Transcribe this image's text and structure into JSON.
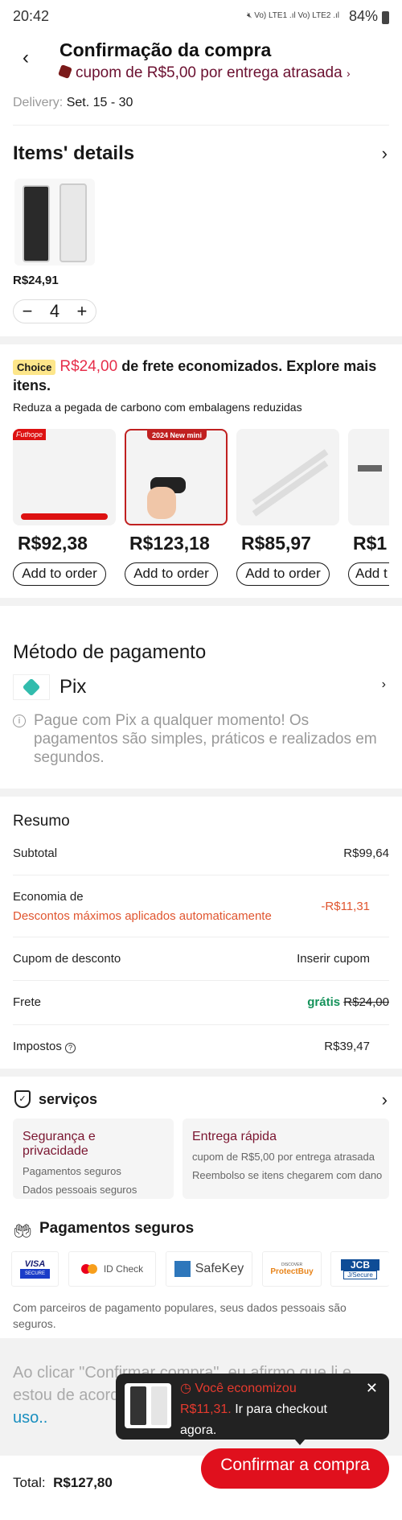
{
  "status_bar": {
    "time": "20:42",
    "battery": "84%",
    "network": "Vo) LTE1 .ıl Vo) LTE2 .ıl"
  },
  "header": {
    "title": "Confirmação da compra",
    "coupon": "cupom de R$5,00 por entrega atrasada"
  },
  "delivery": {
    "label": "Delivery:",
    "value": "Set. 15 - 30"
  },
  "items": {
    "title": "Items' details",
    "price": "R$24,91",
    "quantity": "4",
    "minus": "−",
    "plus": "+"
  },
  "choice": {
    "badge": "Choice",
    "saved": "R$24,00",
    "text": " de frete economizados. Explore mais itens.",
    "subtitle": "Reduza a pegada de carbono com embalagens reduzidas",
    "products": [
      {
        "price": "R$92,38",
        "button": "Add to order",
        "tag": "Futhope"
      },
      {
        "price": "R$123,18",
        "button": "Add to order",
        "tag": "2024 New mini"
      },
      {
        "price": "R$85,97",
        "button": "Add to order"
      },
      {
        "price": "R$1",
        "button": "Add t"
      }
    ],
    "accent": "#e62e4a"
  },
  "payment": {
    "title": "Método de pagamento",
    "method": "Pix",
    "info": "Pague com Pix a qualquer momento! Os pagamentos são simples, práticos e realizados em segundos.",
    "pix_color": "#32bcad"
  },
  "summary": {
    "title": "Resumo",
    "subtotal": {
      "label": "Subtotal",
      "value": "R$99,64"
    },
    "savings": {
      "label": "Economia de",
      "sub": "Descontos máximos aplicados automaticamente",
      "value": "-R$11,31"
    },
    "coupon": {
      "label": "Cupom de desconto",
      "value": "Inserir cupom"
    },
    "shipping": {
      "label": "Frete",
      "free": "grátis",
      "original": "R$24,00"
    },
    "taxes": {
      "label": "Impostos",
      "value": "R$39,47"
    }
  },
  "services": {
    "title": "serviços",
    "cards": [
      {
        "title": "Segurança e privacidade",
        "lines": [
          "Pagamentos seguros",
          "Dados pessoais seguros"
        ]
      },
      {
        "title": "Entrega rápida",
        "lines": [
          "cupom de R$5,00 por entrega atrasada",
          "Reembolso se itens chegarem com dano"
        ]
      }
    ]
  },
  "secure": {
    "title": "Pagamentos seguros",
    "logos": [
      "VISA",
      "SECURE",
      "ID Check",
      "SafeKey",
      "DISCOVER",
      "ProtectBuy",
      "JCB",
      "J/Secure"
    ],
    "text": "Com parceiros de pagamento populares, seus dados pessoais são seguros."
  },
  "terms": {
    "text": "Ao clicar \"Confirmar compra\", eu afirmo que li e estou de acordo com os termos e condições de ",
    "link": "uso.."
  },
  "toast": {
    "title": "Você economizou",
    "amount": "R$11,31.",
    "text": " Ir para checkout agora."
  },
  "footer": {
    "total_label": "Total:",
    "total": "R$127,80",
    "confirm": "Confirmar a compra",
    "brand": "#e0101d"
  }
}
